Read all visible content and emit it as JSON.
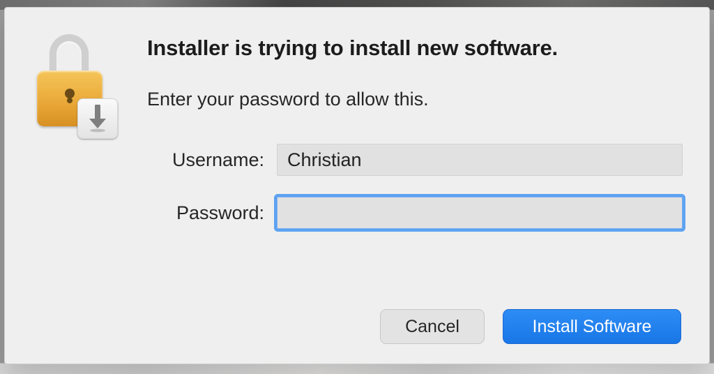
{
  "dialog": {
    "title": "Installer is trying to install new software.",
    "subtitle": "Enter your password to allow this.",
    "fields": {
      "username": {
        "label": "Username:",
        "value": "Christian"
      },
      "password": {
        "label": "Password:",
        "value": ""
      }
    },
    "buttons": {
      "cancel": "Cancel",
      "confirm": "Install Software"
    }
  }
}
